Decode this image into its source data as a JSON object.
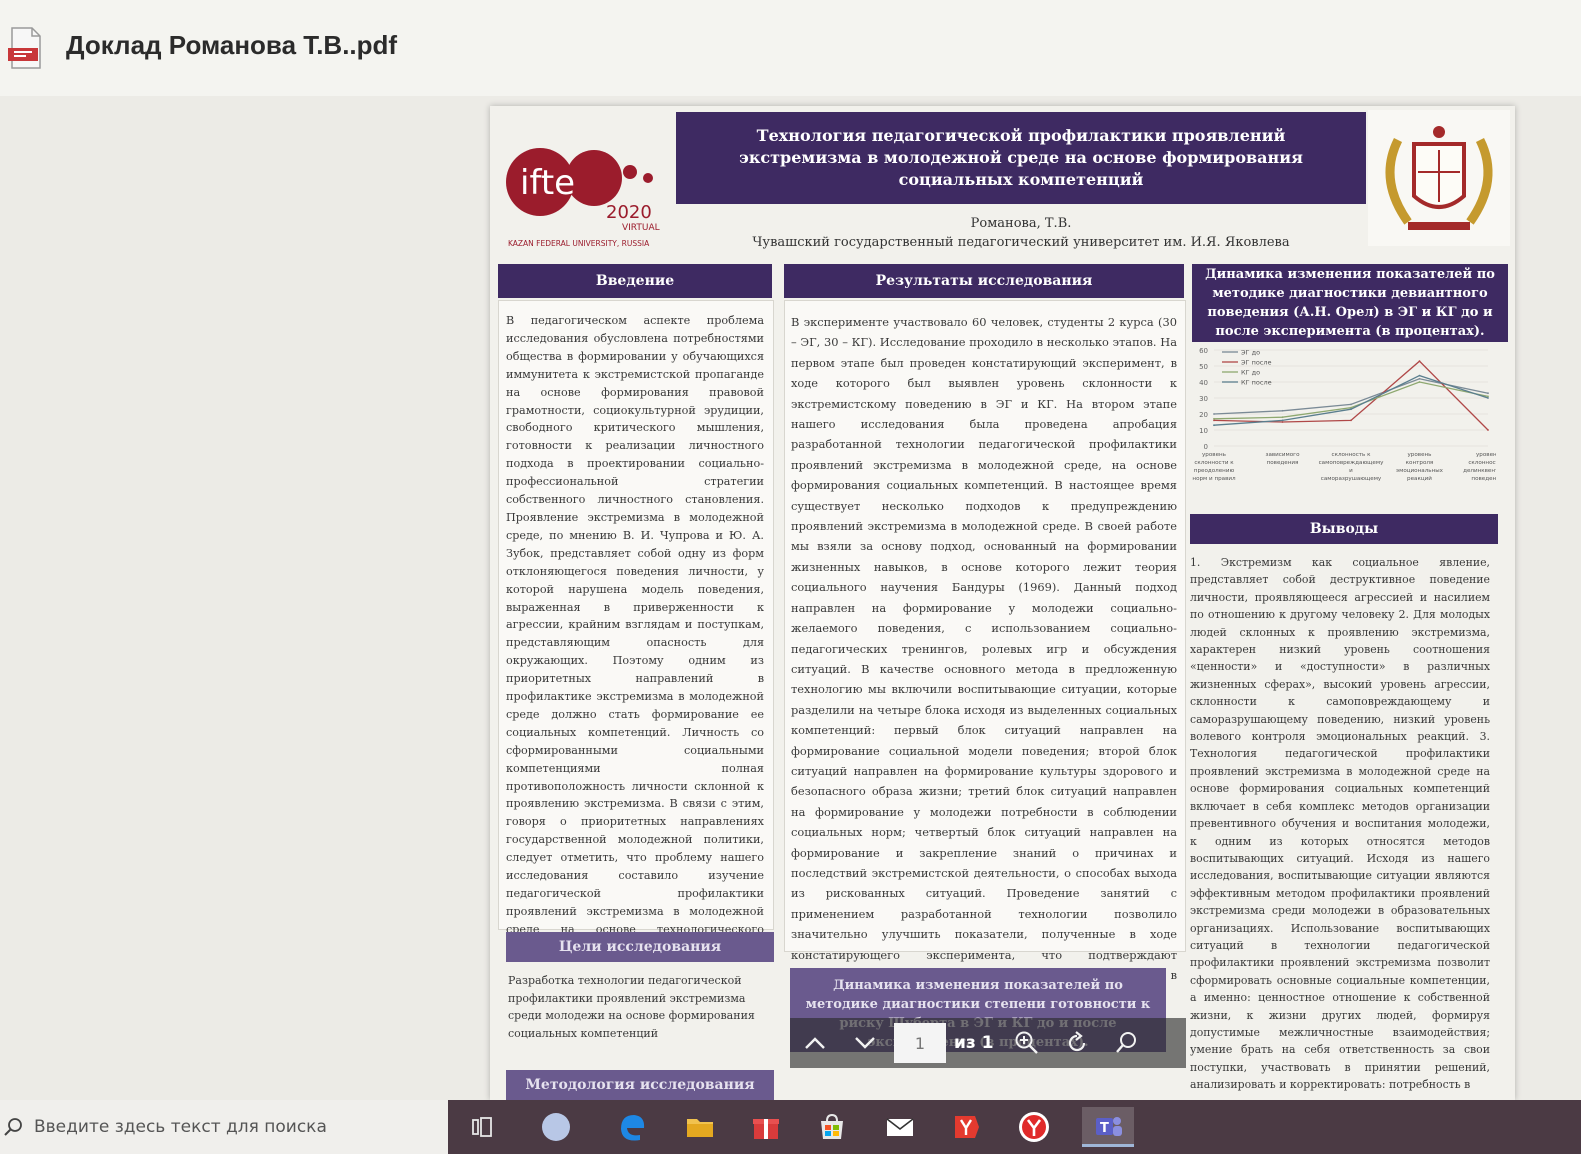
{
  "window": {
    "title": "Доклад Романова Т.В..pdf"
  },
  "poster": {
    "logo_text": "ifte",
    "logo_year": "2020",
    "logo_virtual": "VIRTUAL",
    "logo_org": "KAZAN FEDERAL UNIVERSITY, RUSSIA",
    "title": "Технология педагогической профилактики проявлений экстремизма в молодежной среде на основе формирования социальных компетенций",
    "author": "Романова, Т.В.",
    "affiliation": "Чувашский государственный педагогический университет им. И.Я. Яковлева",
    "intro_heading": "Введение",
    "intro_text": "В педагогическом аспекте проблема исследования обусловлена потребностями общества в формировании у обучающихся иммунитета к экстремистской пропаганде на основе формирования правовой грамотности, социокультурной эрудиции, свободного критического мышления, готовности к реализации личностного подхода в проектировании социально-профессиональной стратегии собственного личностного становления. Проявление экстремизма в молодежной среде, по мнению В. И. Чупрова и Ю. А. Зубок, представляет собой одну из форм отклоняющегося поведения личности, у которой нарушена модель поведения, выраженная в приверженности к агрессии, крайним взглядам и поступкам, представляющим опасность для окружающих. Поэтому одним из приоритетных направлений в профилактике экстремизма в молодежной среде должно стать формирование ее социальных компетенций. Личность со сформированными социальными компетенциями полная противоположность личности склонной к проявлению экстремизма. В связи с этим, говоря о приоритетных направлениях государственной молодежной политики, следует отметить, что проблему нашего исследования составило изучение педагогической профилактики проявлений экстремизма в молодежной среде на основе технологического подхода.",
    "goals_heading": "Цели исследования",
    "goals_text": "Разработка технологии педагогической профилактики проявлений экстремизма среди молодежи на основе формирования социальных компетенций",
    "method_heading": "Методология исследования",
    "results_heading": "Результаты исследования",
    "results_text": "В эксперименте участвовало 60 человек, студенты 2 курса (30 – ЭГ, 30 – КГ). Исследование проходило в несколько этапов. На первом этапе был проведен констатирующий эксперимент, в ходе которого был выявлен уровень склонности к экстремистскому поведению в ЭГ и КГ. На втором этапе нашего исследования была проведена апробация разработанной технологии педагогической профилактики проявлений экстремизма в молодежной среде, на основе формирования социальных компетенций. В настоящее время существует несколько подходов к предупреждению проявлений экстремизма в молодежной среде. В своей работе мы взяли за основу подход, основанный на формировании жизненных навыков, в основе которого лежит теория социального научения Бандуры (1969). Данный подход направлен на формирование у молодежи социально-желаемого поведения, с использованием социально-педагогических тренингов, ролевых игр и обсуждения ситуаций. В качестве основного метода в предложенную технологию мы включили воспитывающие ситуации, которые разделили на четыре блока исходя из выделенных социальных компетенций: первый блок ситуаций направлен на формирование социальной модели поведения; второй блок ситуаций направлен на формирование культуры здорового и безопасного образа жизни; третий блок ситуаций направлен на формирование у молодежи потребности в соблюдении социальных норм; четвертый блок ситуаций направлен на формирование и закрепление знаний о причинах и последствий экстремистской деятельности, о способах выхода из рискованных ситуаций. Проведение занятий с применением разработанной технологии позволило значительно улучшить показатели, полученные в ходе констатирующего эксперимента, что подтверждают результаты контрольного этапа эксперимента. Показатели в ЭГ значительно улучшились, в КГ остались прежними.",
    "dyn2_heading": "Динамика изменения показателей по методике диагностики степени готовности к риску Шуберта в ЭГ и КГ до и после эксперимента (в процентах).",
    "dyn1_heading": "Динамика изменения показателей по методике диагностики девиантного поведения (А.Н. Орел) в ЭГ и КГ до и после эксперимента (в процентах).",
    "conclusions_heading": "Выводы",
    "conclusions_text": "1. Экстремизм как социальное явление, представляет собой деструктивное поведение личности, проявляющееся агрессией и насилием по отношению к другому человеку 2. Для молодых людей склонных к проявлению экстремизма, характерен низкий уровень соотношения «ценности» и «доступности» в различных жизненных сферах», высокий уровень агрессии, склонности к самоповреждающему и саморазрушающему поведению, низкий уровень волевого контроля эмоциональных реакций. 3. Технология педагогической профилактики проявлений экстремизма в молодежной среде на основе формирования социальных компетенций включает в себя комплекс методов организации превентивного обучения и воспитания молодежи, к одним из которых относятся методов воспитывающих ситуаций. Исходя из нашего исследования, воспитывающие ситуации являются эффективным методом профилактики проявлений экстремизма среди молодежи в образовательных организациях. Использование воспитывающих ситуаций в технологии педагогической профилактики проявлений экстремизма позволит сформировать основные социальные компетенции, а именно: ценностное отношение к собственной жизни, к жизни других людей, формируя допустимые межличностные взаимодействия; умение брать на себя ответственность за свои поступки, участвовать в принятии решений, анализировать и корректировать: потребность в"
  },
  "chart_data": {
    "type": "line",
    "categories": [
      "уровень склонности к преодолению норм и правил",
      "зависимого поведения",
      "склонность к самоповреждающему и саморазрушающему",
      "уровень контроля эмоциональных реакций",
      "уровень склонности к делинквентному поведению"
    ],
    "ylim": [
      0,
      60
    ],
    "yticks": [
      0,
      10,
      20,
      30,
      40,
      50,
      60
    ],
    "series": [
      {
        "name": "ЭГ до",
        "color": "#7a8a96",
        "values": [
          20,
          22,
          26,
          42,
          33
        ]
      },
      {
        "name": "ЭГ после",
        "color": "#b04848",
        "values": [
          16,
          15,
          16,
          53,
          10
        ]
      },
      {
        "name": "КГ до",
        "color": "#8ea870",
        "values": [
          17,
          18,
          24,
          40,
          31
        ]
      },
      {
        "name": "КГ после",
        "color": "#5a7e8e",
        "values": [
          13,
          16,
          23,
          44,
          30
        ]
      }
    ]
  },
  "toolbar": {
    "page_value": "1",
    "page_of": "из 1"
  },
  "taskbar": {
    "search_placeholder": "Введите здесь текст для поиска"
  }
}
